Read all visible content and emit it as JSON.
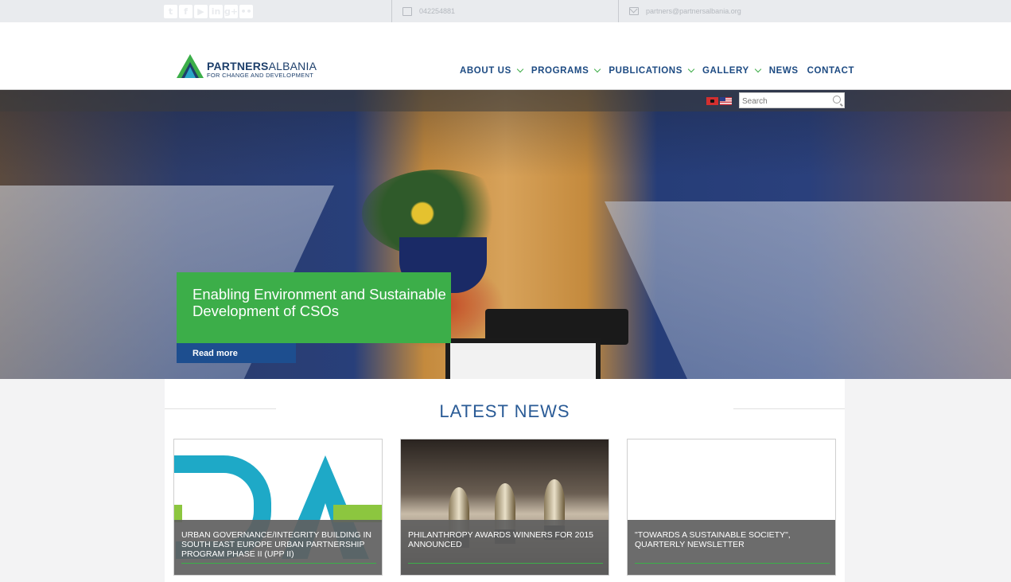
{
  "topbar": {
    "social_icons": [
      "twitter-icon",
      "facebook-icon",
      "youtube-icon",
      "linkedin-icon",
      "googleplus-icon",
      "flickr-icon"
    ],
    "social_glyphs": [
      "t",
      "f",
      "▶",
      "in",
      "g+",
      "••"
    ],
    "phone": "042254881",
    "email": "partners@partnersalbania.org"
  },
  "logo": {
    "name_bold": "PARTNERS",
    "name_light": "ALBANIA",
    "tagline": "FOR CHANGE AND DEVELOPMENT"
  },
  "nav": {
    "items": [
      {
        "label": "ABOUT US",
        "dropdown": true
      },
      {
        "label": "PROGRAMS",
        "dropdown": true
      },
      {
        "label": "PUBLICATIONS",
        "dropdown": true
      },
      {
        "label": "GALLERY",
        "dropdown": true
      },
      {
        "label": "NEWS",
        "dropdown": false
      },
      {
        "label": "CONTACT",
        "dropdown": false
      }
    ]
  },
  "hero": {
    "search_placeholder": "Search",
    "flags": [
      "albanian-flag-icon",
      "us-flag-icon"
    ],
    "caption": "Enabling Environment and Sustainable Development of CSOs",
    "read_more": "Read more"
  },
  "news": {
    "title": "LATEST NEWS",
    "cards": [
      {
        "title": "URBAN GOVERNANCE/INTEGRITY BUILDING IN SOUTH EAST EUROPE URBAN PARTNERSHIP PROGRAM PHASE II (UPP II)"
      },
      {
        "title": "PHILANTHROPY AWARDS WINNERS FOR 2015 ANNOUNCED"
      },
      {
        "title": "\"TOWARDS A SUSTAINABLE SOCIETY\", QUARTERLY NEWSLETTER"
      }
    ]
  },
  "colors": {
    "brand_blue": "#1c4a82",
    "brand_green": "#3cae49",
    "read_more_bg": "#1d4e8f"
  }
}
